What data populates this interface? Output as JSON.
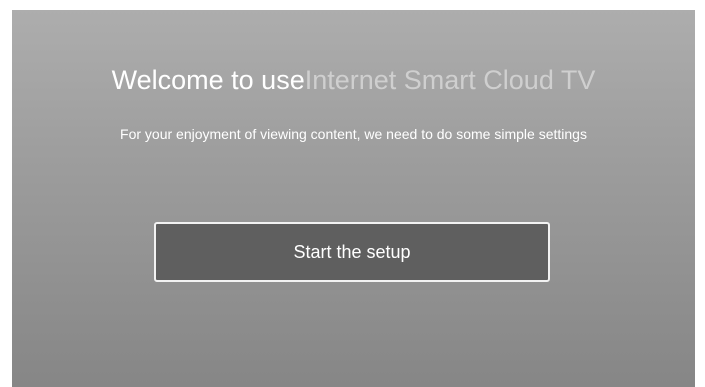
{
  "welcome": {
    "title_prefix": "Welcome to use",
    "title_product": "Internet Smart Cloud TV",
    "subtitle": "For your enjoyment of viewing content, we need to do some simple settings"
  },
  "actions": {
    "start_label": "Start the setup"
  },
  "colors": {
    "background_top": "#adadad",
    "background_bottom": "#868686",
    "button_fill": "#5f5f5f",
    "button_border": "#f2f2f2",
    "product_text": "#cfcfcf"
  }
}
